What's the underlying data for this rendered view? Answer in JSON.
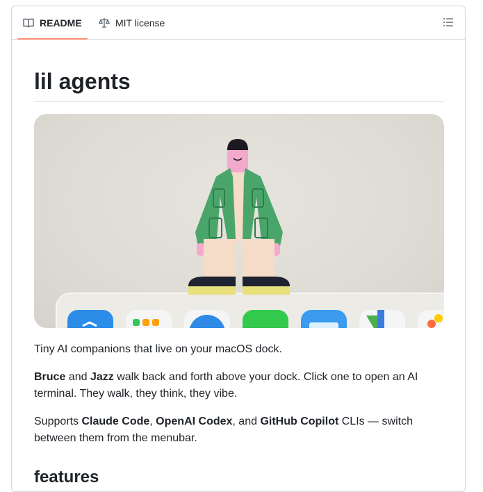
{
  "tabs": {
    "readme_label": "README",
    "license_label": "MIT license"
  },
  "readme": {
    "title": "lil agents",
    "intro": "Tiny AI companions that live on your macOS dock.",
    "p2": {
      "name1": "Bruce",
      "and": " and ",
      "name2": "Jazz",
      "rest": " walk back and forth above your dock. Click one to open an AI terminal. They walk, they think, they vibe."
    },
    "p3": {
      "pre": "Supports ",
      "cli1": "Claude Code",
      "sep1": ", ",
      "cli2": "OpenAI Codex",
      "sep2": ", and ",
      "cli3": "GitHub Copilot",
      "rest": " CLIs — switch between them from the menubar."
    },
    "section_heading": "features"
  },
  "icons": {
    "readme": "book-icon",
    "license": "law-scale-icon",
    "toc": "list-unordered-icon"
  },
  "colors": {
    "accent_underline": "#fd8c73",
    "text": "#1f2328",
    "border": "#d0d7de"
  }
}
